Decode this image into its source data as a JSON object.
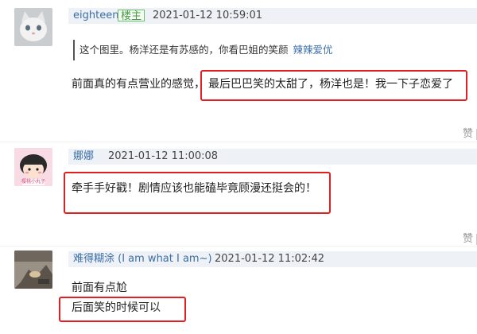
{
  "comments": [
    {
      "username": "eighteen",
      "badge": "楼主",
      "timestamp": "2021-01-12 10:59:01",
      "quote_text": "这个图里。杨洋还是有苏感的，你看巴姐的笑颜",
      "quote_author": "辣辣爱优",
      "text_plain": "前面真的有点营业的感觉，",
      "text_boxed": "最后巴巴笑的太甜了，杨洋也是！我一下子恋爱了",
      "like_label": "赞"
    },
    {
      "username": "娜娜",
      "timestamp": "2021-01-12 11:00:08",
      "text_boxed": "牵手手好戳！剧情应该也能磕毕竟顾漫还挺会的！",
      "avatar_caption": "樱桃小丸子",
      "like_label": "赞"
    },
    {
      "username": "难得糊涂 (I am what I am~)",
      "timestamp": "2021-01-12 11:02:42",
      "text_line1": "前面有点尬",
      "text_boxed": "后面笑的时候可以"
    }
  ],
  "colors": {
    "username": "#3a6ea5",
    "highlight_box": "#e02020",
    "header_bg": "#eef2f7"
  }
}
